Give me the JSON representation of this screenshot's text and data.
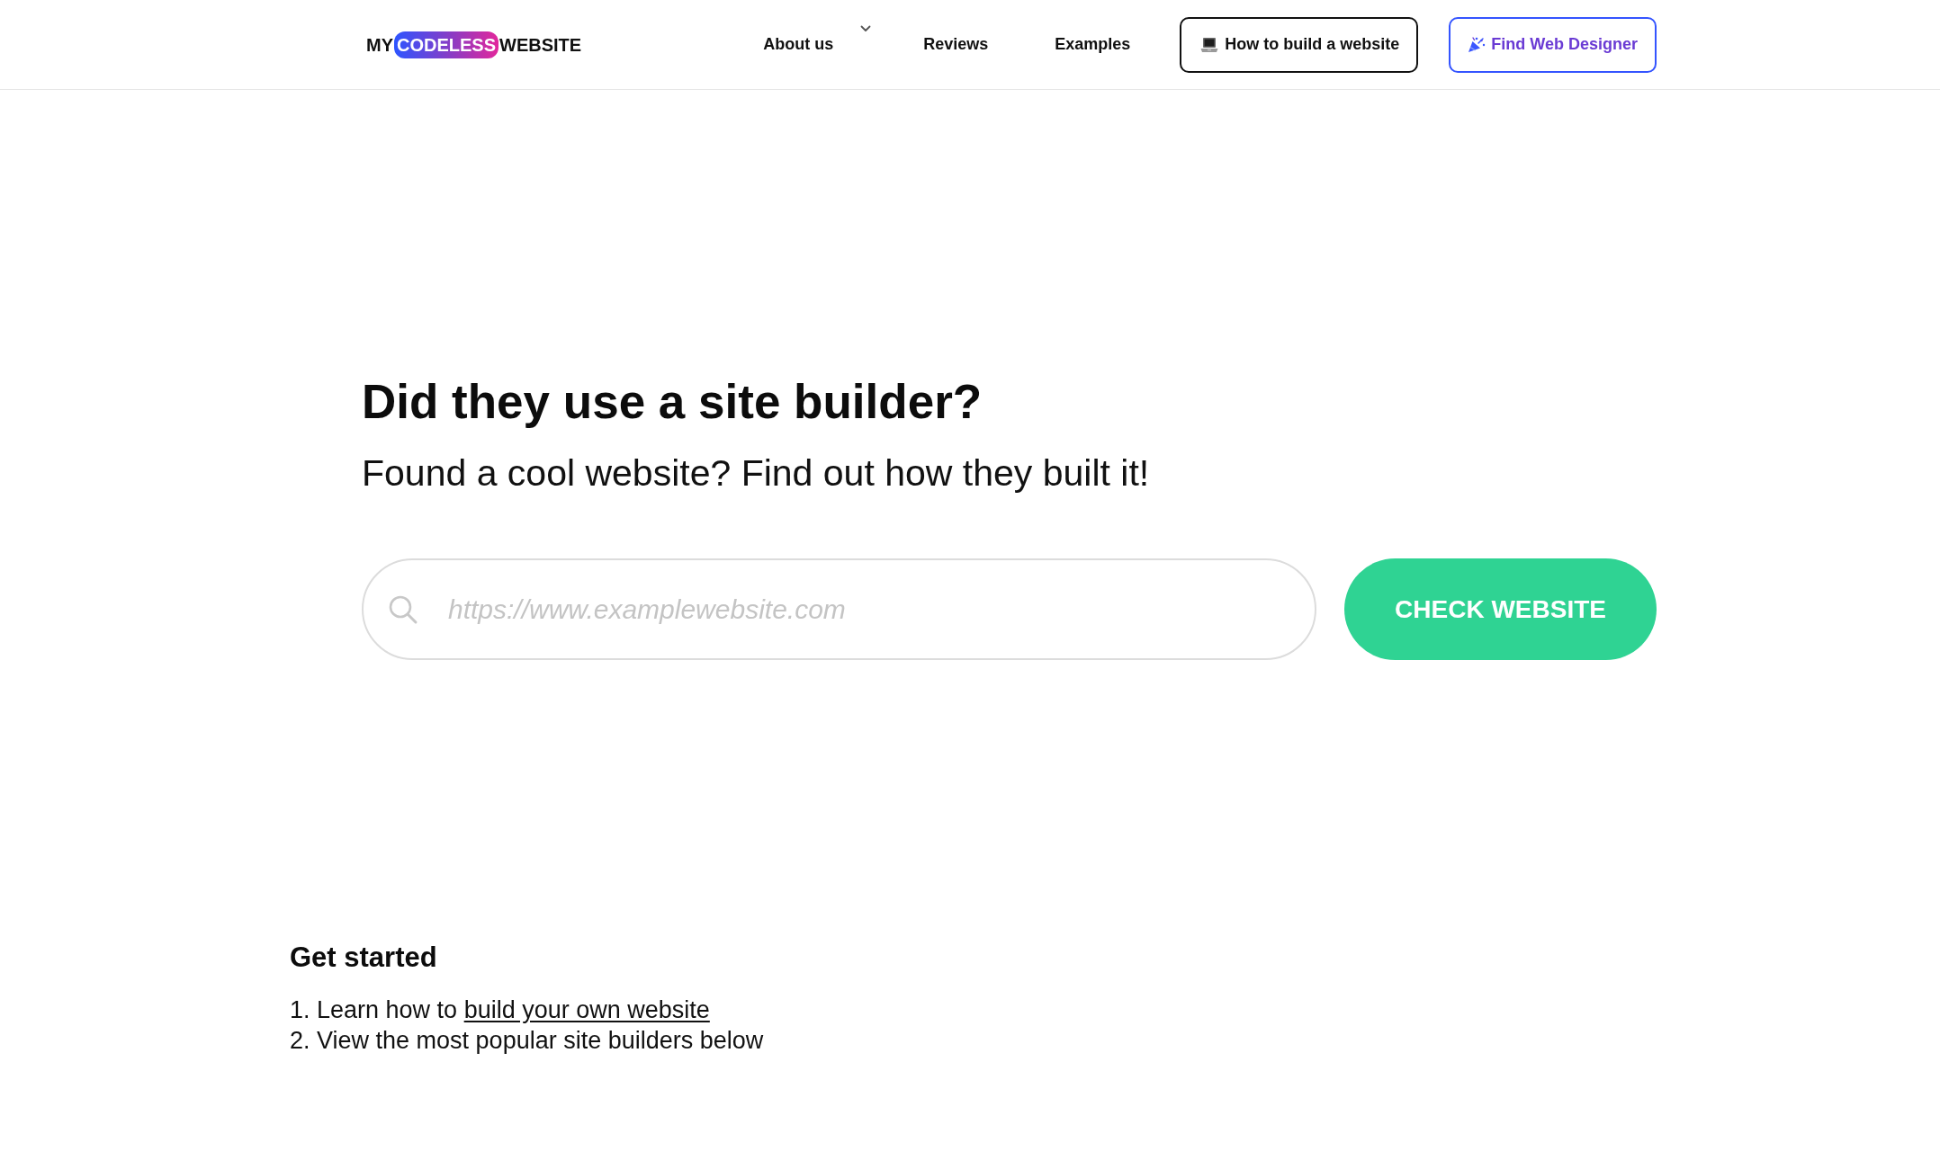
{
  "header": {
    "logo": [
      {
        "text": "MY",
        "kind": "plain"
      },
      {
        "text": "CODELESS",
        "kind": "pill"
      },
      {
        "text": "WEBSITE",
        "kind": "plain"
      }
    ],
    "nav": [
      {
        "label": "About us",
        "kind": "dropdown"
      },
      {
        "label": "Reviews",
        "kind": "link"
      },
      {
        "label": "Examples",
        "kind": "link"
      },
      {
        "label": "How to build a website",
        "kind": "outline-button"
      },
      {
        "label": "Find Web Designer",
        "kind": "accent-button"
      }
    ]
  },
  "hero": {
    "title": "Did they use a site builder?",
    "subtitle": "Found a cool website? Find out how they built it!",
    "search": {
      "placeholder": "https://www.examplewebsite.com"
    },
    "submit_button": "CHECK WEBSITE"
  },
  "get_started": {
    "title": "Get started",
    "steps": [
      {
        "text": "1. Learn how to",
        "link": "build your own website"
      },
      {
        "text": "2. View the most popular site builders below"
      }
    ]
  }
}
